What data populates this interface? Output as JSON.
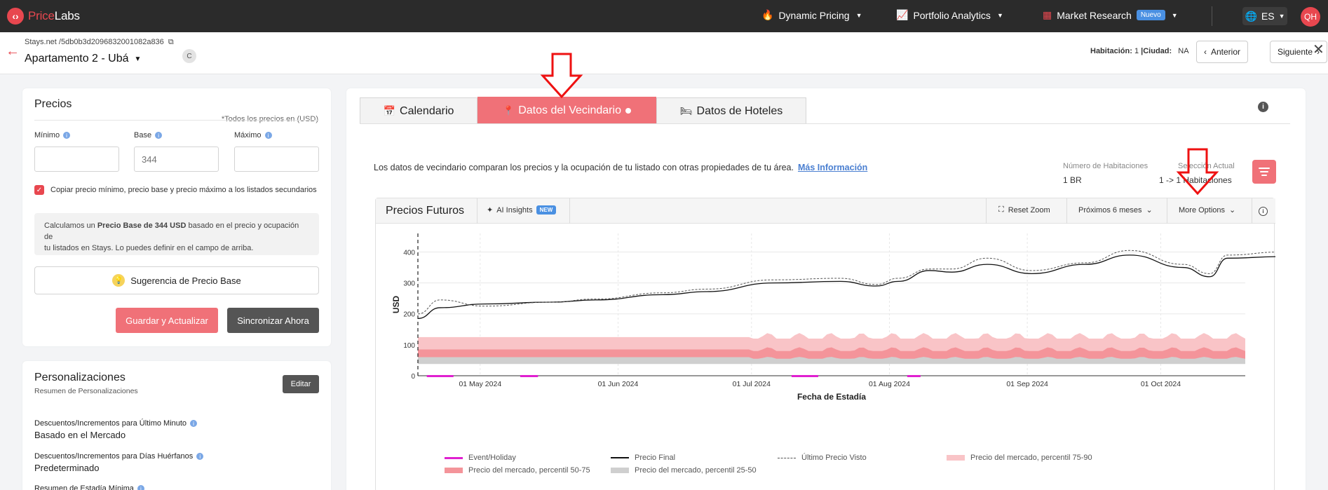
{
  "nav": {
    "brand_a": "Price",
    "brand_b": "Labs",
    "dynamic_pricing": "Dynamic Pricing",
    "portfolio_analytics": "Portfolio Analytics",
    "market_research": "Market Research",
    "nuevo_badge": "Nuevo",
    "language": "ES",
    "avatar_initials": "QH"
  },
  "header": {
    "listing_id": "Stays.net /5db0b3d2096832001082a836",
    "listing_name": "Apartamento 2 - Ubá",
    "channel_badge": "C",
    "hab_label": "Habitación:",
    "hab_value": "1",
    "ciudad_label": "|Ciudad:",
    "ciudad_value": "NA",
    "prev_label": "Anterior",
    "next_label": "Siguiente"
  },
  "precios": {
    "title": "Precios",
    "usd_note": "*Todos los precios en (USD)",
    "min_label": "Mínimo",
    "base_label": "Base",
    "max_label": "Máximo",
    "min_value": "",
    "base_placeholder": "344",
    "max_value": "",
    "copy_text": "Copiar precio mínimo, precio base y precio máximo a los listados secundarios",
    "info_pre": "Calculamos un ",
    "info_bold": "Precio Base de 344 USD",
    "info_post": " basado en el precio y ocupación de",
    "info_line2": "tu listados en Stays. Lo puedes definir en el campo de arriba.",
    "suggest_label": "Sugerencia de Precio Base",
    "save_label": "Guardar y Actualizar",
    "sync_label": "Sincronizar Ahora"
  },
  "personalizaciones": {
    "title": "Personalizaciones",
    "subtitle": "Resumen de Personalizaciones",
    "edit_label": "Editar",
    "items": [
      {
        "label": "Descuentos/Incrementos para Último Minuto",
        "value": "Basado en el Mercado"
      },
      {
        "label": "Descuentos/Incrementos para Días Huérfanos",
        "value": "Predeterminado"
      },
      {
        "label": "Resumen de Estadía Mínima",
        "value": ""
      }
    ]
  },
  "tabs": {
    "calendario": "Calendario",
    "vecindario": "Datos del Vecindario",
    "hoteles": "Datos de Hoteles"
  },
  "vecindario": {
    "description": "Los datos de vecindario comparan los precios y la ocupación de tu listado con otras propiedades de tu área.",
    "more_info": "Más Información",
    "num_hab_label": "Número de Habitaciones",
    "num_hab_value": "1 BR",
    "sel_label": "Selección Actual",
    "sel_value": "1 -> 1 Habitaciones"
  },
  "chart_header": {
    "title": "Precios Futuros",
    "ai_insights": "AI Insights",
    "new_badge": "NEW",
    "reset_zoom": "Reset Zoom",
    "range": "Próximos 6 meses",
    "more_options": "More Options"
  },
  "chart_data": {
    "type": "line",
    "xlabel": "Fecha de Estadía",
    "ylabel": "USD",
    "ylim": [
      0,
      460
    ],
    "y_ticks": [
      "0",
      "100",
      "200",
      "300",
      "400"
    ],
    "x_ticks": [
      "01 May 2024",
      "01 Jun 2024",
      "01 Jul 2024",
      "01 Aug 2024",
      "01 Sep 2024",
      "01 Oct 2024"
    ],
    "x_range": [
      "2024-04-17",
      "2024-10-20"
    ],
    "series": [
      {
        "name": "Precio Final",
        "color": "#111111",
        "style": "solid",
        "values": [
          [
            0,
            185
          ],
          [
            5,
            220
          ],
          [
            15,
            232
          ],
          [
            30,
            238
          ],
          [
            40,
            245
          ],
          [
            55,
            262
          ],
          [
            65,
            272
          ],
          [
            80,
            300
          ],
          [
            95,
            305
          ],
          [
            103,
            290
          ],
          [
            108,
            305
          ],
          [
            115,
            340
          ],
          [
            120,
            335
          ],
          [
            128,
            360
          ],
          [
            138,
            330
          ],
          [
            150,
            360
          ],
          [
            160,
            390
          ],
          [
            172,
            350
          ],
          [
            178,
            320
          ],
          [
            182,
            380
          ],
          [
            194,
            385
          ],
          [
            205,
            350
          ],
          [
            212,
            360
          ],
          [
            220,
            378
          ],
          [
            230,
            395
          ],
          [
            241,
            360
          ],
          [
            252,
            380
          ],
          [
            265,
            405
          ],
          [
            275,
            390
          ],
          [
            285,
            415
          ],
          [
            295,
            385
          ],
          [
            305,
            395
          ],
          [
            315,
            355
          ],
          [
            325,
            360
          ],
          [
            335,
            348
          ],
          [
            340,
            345
          ],
          [
            345,
            365
          ],
          [
            350,
            340
          ],
          [
            356,
            375
          ]
        ]
      },
      {
        "name": "Último Precio Visto",
        "color": "#555555",
        "style": "dashed",
        "values": [
          [
            0,
            200
          ],
          [
            5,
            245
          ],
          [
            15,
            225
          ],
          [
            30,
            238
          ],
          [
            40,
            248
          ],
          [
            55,
            268
          ],
          [
            65,
            280
          ],
          [
            80,
            310
          ],
          [
            95,
            315
          ],
          [
            103,
            295
          ],
          [
            108,
            315
          ],
          [
            115,
            345
          ],
          [
            120,
            345
          ],
          [
            128,
            380
          ],
          [
            138,
            340
          ],
          [
            150,
            365
          ],
          [
            160,
            405
          ],
          [
            172,
            360
          ],
          [
            178,
            330
          ],
          [
            182,
            390
          ],
          [
            194,
            400
          ],
          [
            205,
            360
          ],
          [
            212,
            375
          ],
          [
            220,
            388
          ],
          [
            230,
            400
          ],
          [
            241,
            370
          ],
          [
            252,
            392
          ],
          [
            265,
            412
          ],
          [
            275,
            400
          ],
          [
            285,
            425
          ],
          [
            295,
            395
          ],
          [
            305,
            402
          ],
          [
            315,
            365
          ],
          [
            325,
            368
          ],
          [
            335,
            355
          ],
          [
            340,
            355
          ],
          [
            345,
            372
          ],
          [
            350,
            350
          ],
          [
            356,
            378
          ]
        ]
      }
    ],
    "bands": [
      {
        "name": "Precio del mercado, percentil 75-90",
        "color": "#f9c4c7",
        "low": 75,
        "high": 120
      },
      {
        "name": "Precio del mercado, percentil 50-75",
        "color": "#f4949a",
        "low": 50,
        "high": 80
      },
      {
        "name": "Precio del mercado, percentil 25-50",
        "color": "#cfcfcf",
        "low": 38,
        "high": 55
      }
    ],
    "events": {
      "name": "Event/Holiday",
      "color": "#e020d0"
    }
  },
  "colors": {
    "brand_red": "#e8474f",
    "tab_active": "#f07178",
    "nav_bg": "#2b2b2b"
  }
}
